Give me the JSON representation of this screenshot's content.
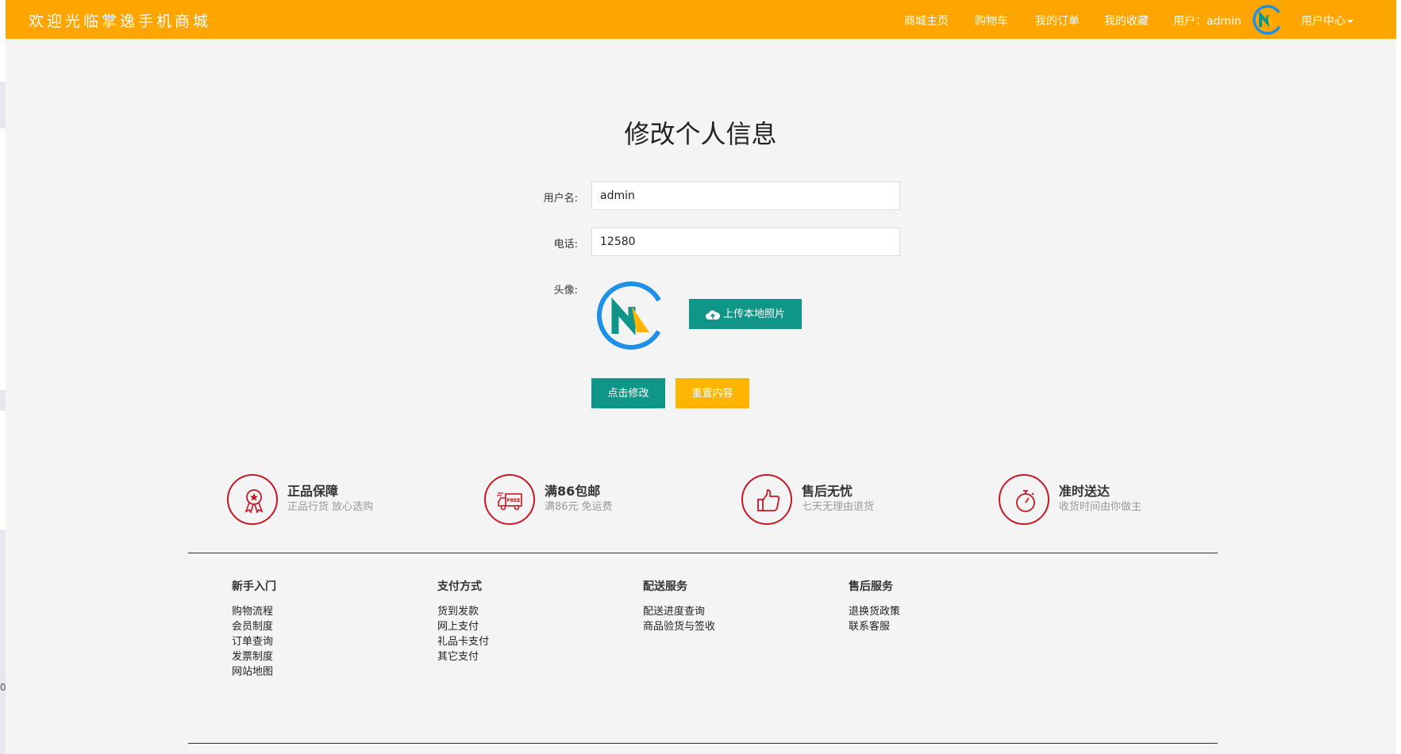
{
  "header": {
    "brand": "欢迎光临掌逸手机商城",
    "nav": [
      {
        "label": "商城主页"
      },
      {
        "label": "购物车"
      },
      {
        "label": "我的订单"
      },
      {
        "label": "我的收藏"
      },
      {
        "label": "用户：admin"
      }
    ],
    "user_center_label": "用户中心",
    "avatar_icon": "brand-logo-icon"
  },
  "form": {
    "title": "修改个人信息",
    "username_label": "用户名:",
    "username_value": "admin",
    "phone_label": "电话:",
    "phone_value": "12580",
    "avatar_label": "头像:",
    "upload_label": "上传本地照片",
    "submit_label": "点击修改",
    "reset_label": "重置内容"
  },
  "features": [
    {
      "icon": "medal-icon",
      "title": "正品保障",
      "subtitle": "正品行货 放心选购"
    },
    {
      "icon": "free-shipping-truck-icon",
      "title": "满86包邮",
      "subtitle": "满86元 免运费"
    },
    {
      "icon": "thumbs-up-icon",
      "title": "售后无忧",
      "subtitle": "七天无理由退货"
    },
    {
      "icon": "stopwatch-icon",
      "title": "准时送达",
      "subtitle": "收货时间由你做主"
    }
  ],
  "footer": {
    "columns": [
      {
        "title": "新手入门",
        "links": [
          "购物流程",
          "会员制度",
          "订单查询",
          "发票制度",
          "网站地图"
        ]
      },
      {
        "title": "支付方式",
        "links": [
          "货到发款",
          "网上支付",
          "礼品卡支付",
          "其它支付"
        ]
      },
      {
        "title": "配送服务",
        "links": [
          "配送进度查询",
          "商品验货与签收"
        ]
      },
      {
        "title": "售后服务",
        "links": [
          "退换货政策",
          "联系客服"
        ]
      }
    ]
  },
  "side_glyph": "0",
  "colors": {
    "header_bg": "#ffa500",
    "primary_button": "#109688",
    "reset_button": "#ffb400",
    "feature_red": "#c81623"
  }
}
